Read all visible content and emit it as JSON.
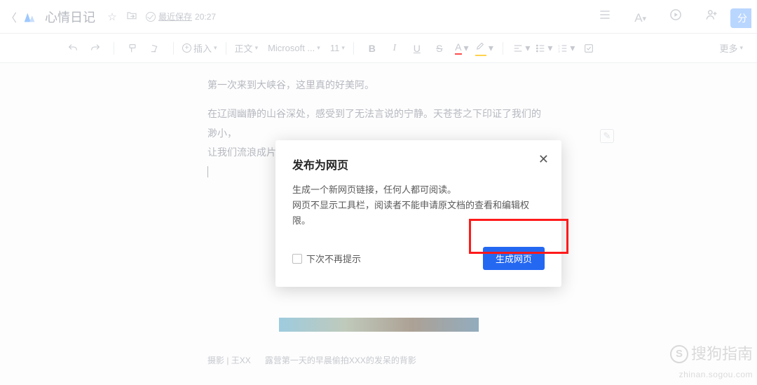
{
  "header": {
    "doc_title": "心情日记",
    "save_label": "最近保存",
    "save_time": "20:27",
    "share_btn": "分"
  },
  "toolbar": {
    "insert": "插入",
    "para_style": "正文",
    "font": "Microsoft ...",
    "size": "11",
    "bold": "B",
    "italic": "I",
    "underline": "U",
    "strike": "S",
    "color": "A",
    "more": "更多"
  },
  "document": {
    "p1": "第一次来到大峡谷，这里真的好美阿。",
    "p2a": "在辽阔幽静的山谷深处，感受到了无法言说的宁静。天苍苍之下印证了我们的渺小，",
    "p2b": "让我们流浪成片片白云，或是一只只欢快的羊儿，亦或是一株株坚韧的小草。",
    "caption_a": "摄影 | 王XX",
    "caption_b": "露营第一天的早晨偷拍XXX的发呆的背影"
  },
  "modal": {
    "title": "发布为网页",
    "line1": "生成一个新网页链接，任何人都可阅读。",
    "line2": "网页不显示工具栏，阅读者不能申请原文档的查看和编辑权限。",
    "checkbox": "下次不再提示",
    "confirm": "生成网页"
  },
  "watermark": {
    "main": "搜狗指南",
    "sub": "zhinan.sogou.com"
  }
}
